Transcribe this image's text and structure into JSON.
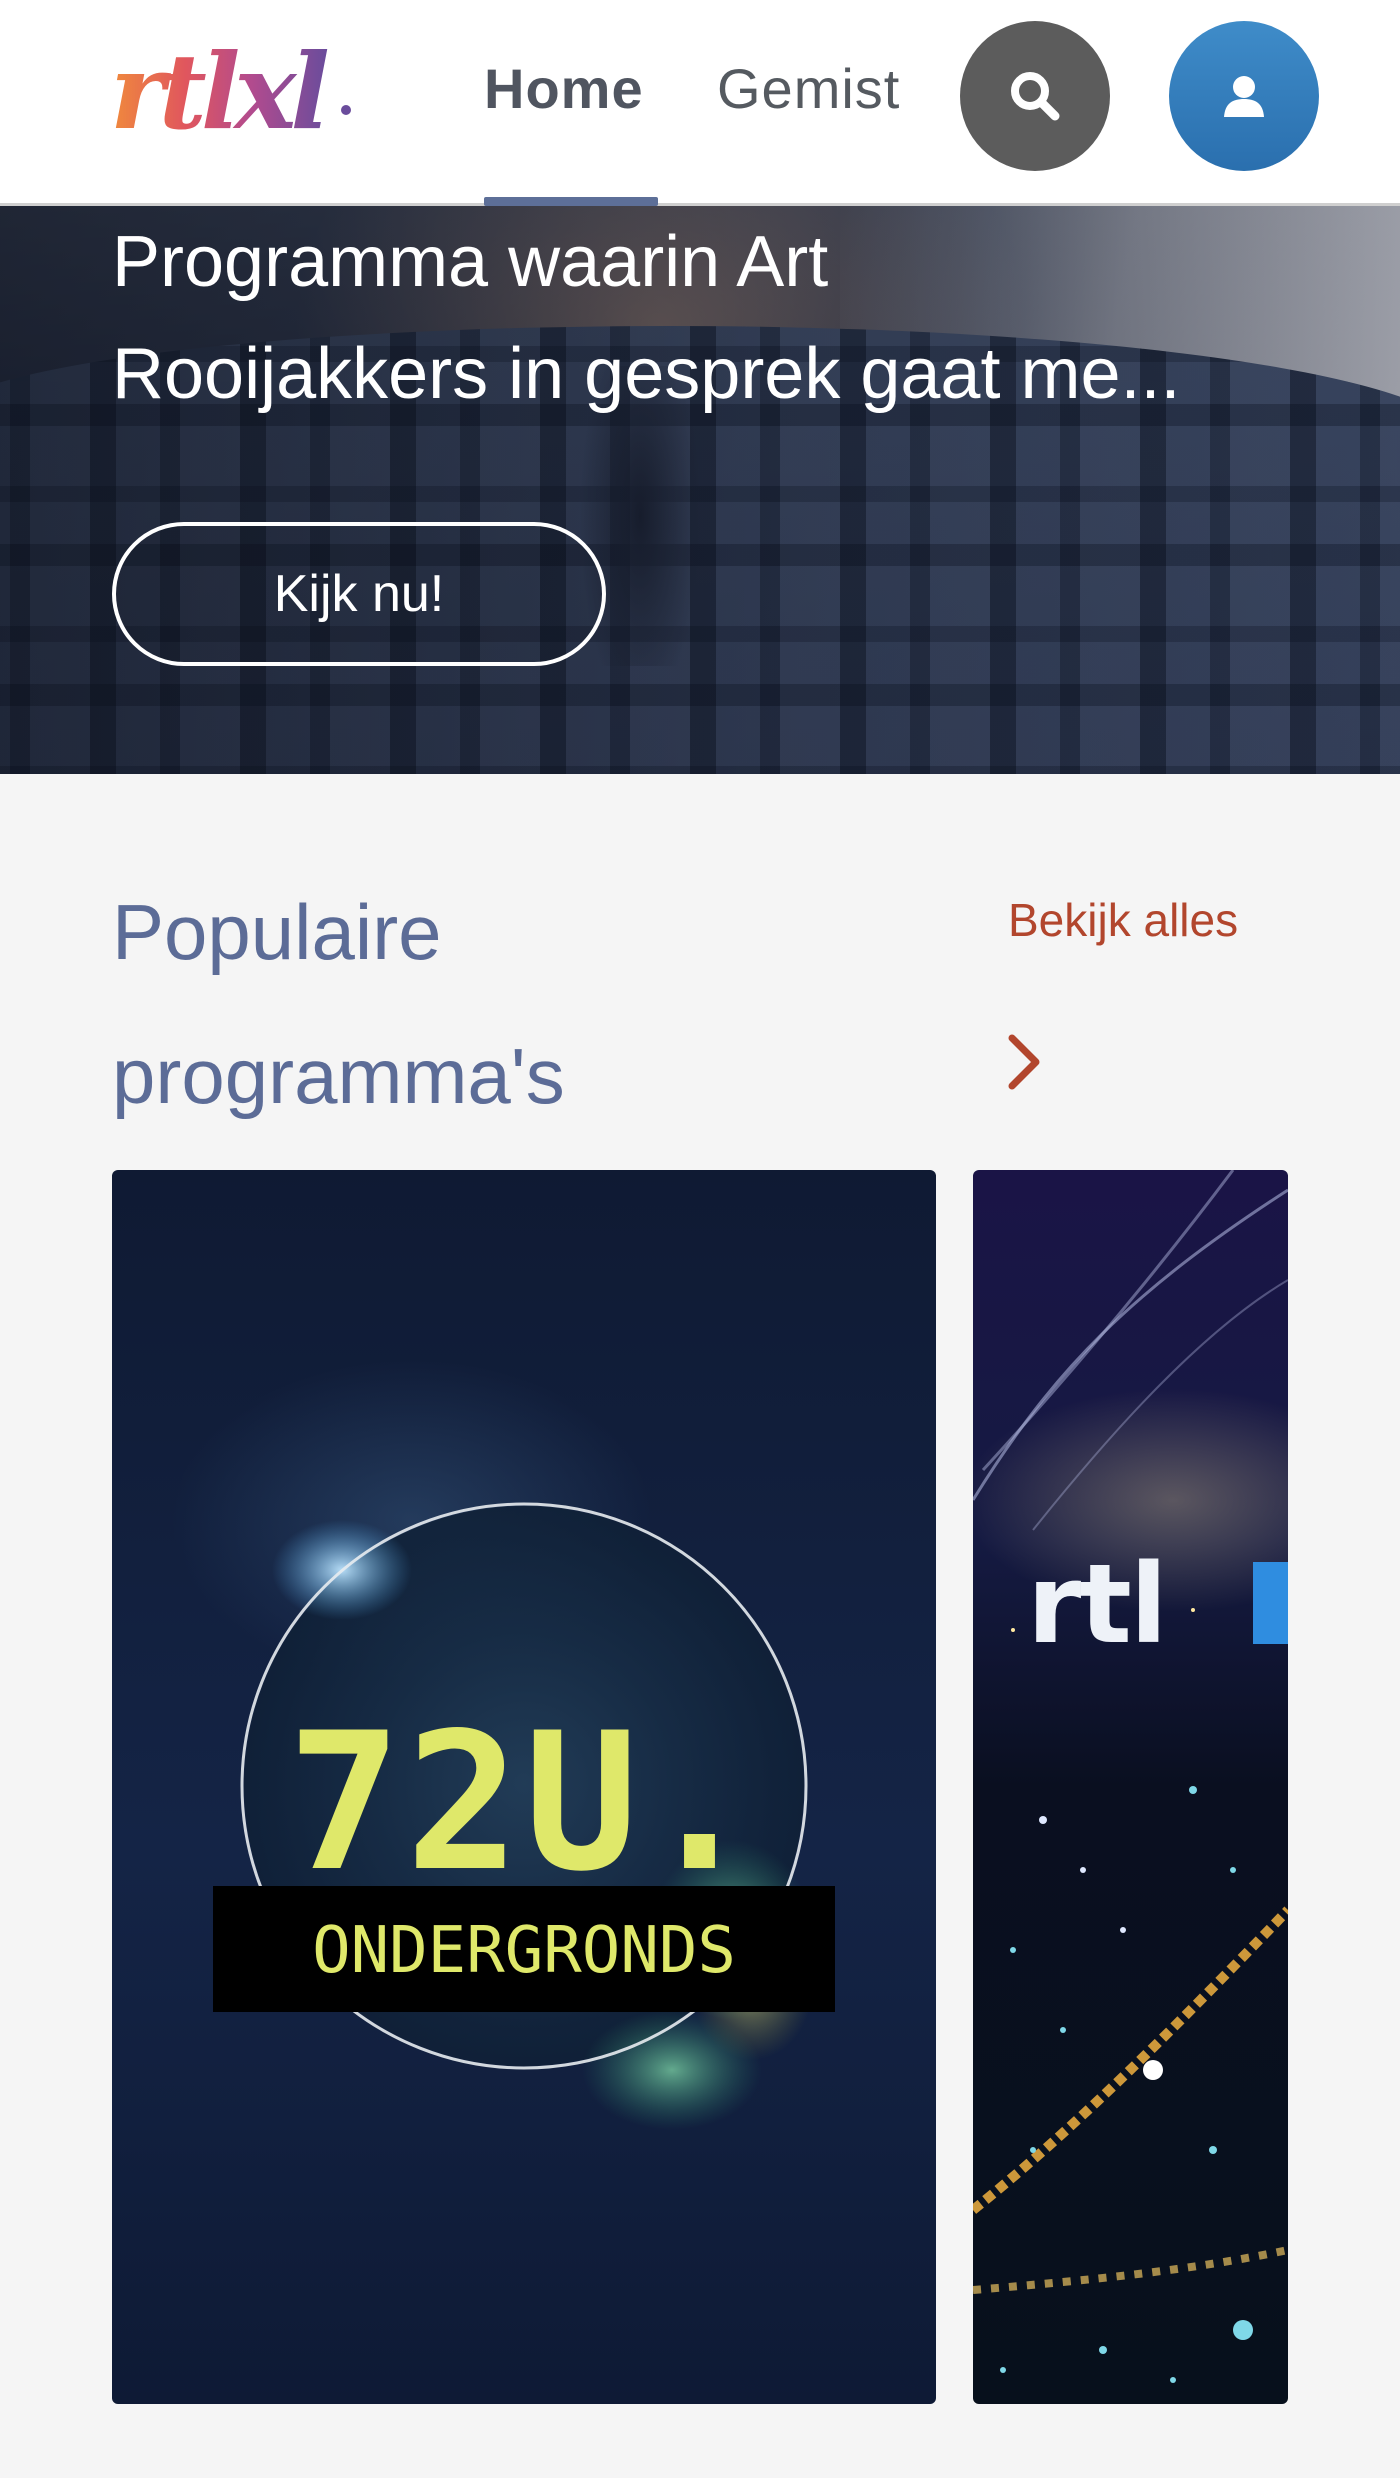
{
  "header": {
    "logo_text": "rtlxl",
    "tabs": [
      {
        "label": "Home",
        "active": true
      },
      {
        "label": "Gemist",
        "active": false
      }
    ],
    "search_icon": "search-icon",
    "account_icon": "user-icon",
    "colors": {
      "active_tab_underline": "#5d6f98",
      "search_button": "#5c5c5c",
      "account_button": "#3579b8"
    }
  },
  "hero": {
    "description_line1": "Programma waarin Art",
    "description_line2": "Rooijakkers in gesprek gaat me...",
    "cta_label": "Kijk nu!"
  },
  "popular": {
    "title_line1": "Populaire",
    "title_line2": "programma's",
    "see_all_label": "Bekijk alles",
    "see_all_icon": "chevron-right-icon",
    "colors": {
      "title": "#5c6c97",
      "see_all": "#b2462d"
    },
    "cards": [
      {
        "title_top": "72U.",
        "title_bottom": "ONDERGRONDS"
      },
      {
        "title": "rtl"
      }
    ]
  }
}
